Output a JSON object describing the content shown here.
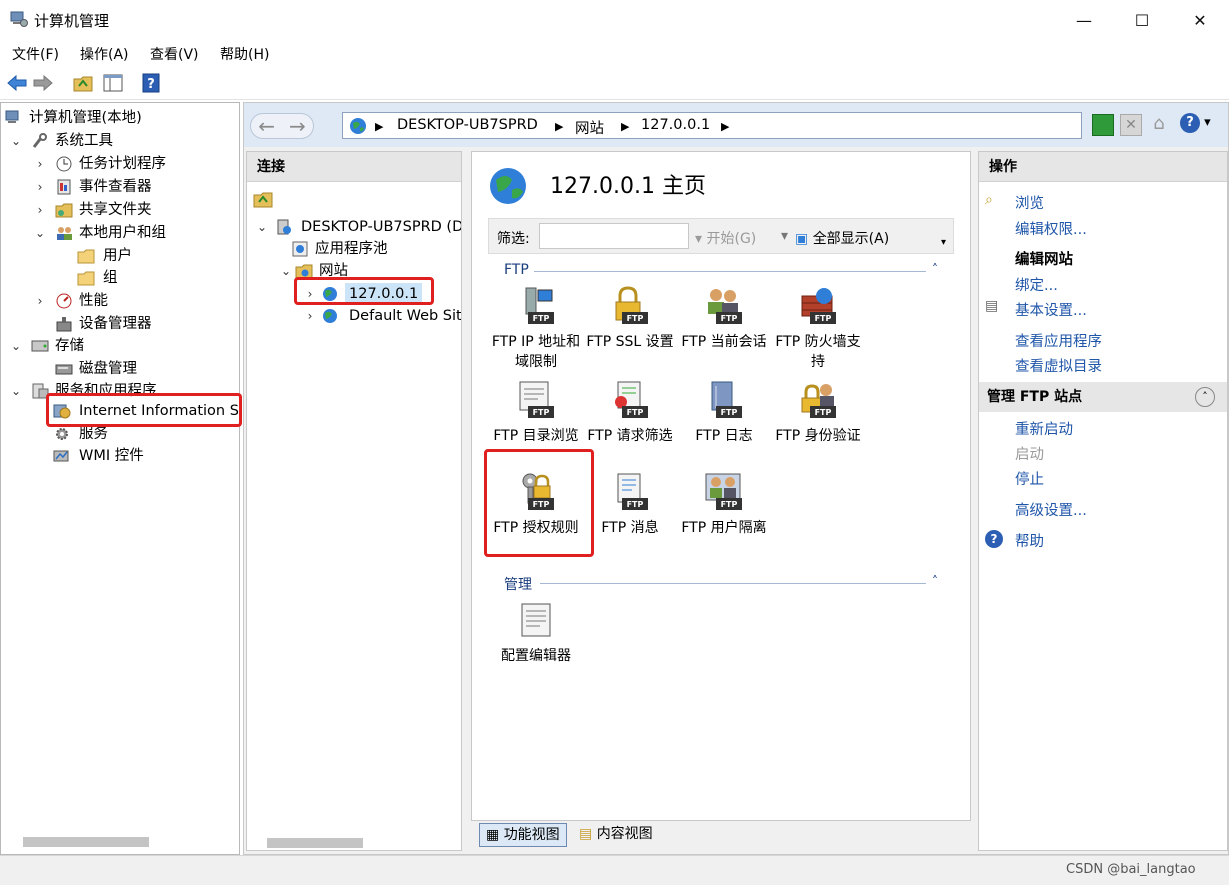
{
  "window": {
    "title": "计算机管理",
    "controls": [
      "—",
      "☐",
      "✕"
    ]
  },
  "menu": [
    "文件(F)",
    "操作(A)",
    "查看(V)",
    "帮助(H)"
  ],
  "left_tree": {
    "root": "计算机管理(本地)",
    "system_tools": "系统工具",
    "task_scheduler": "任务计划程序",
    "event_viewer": "事件查看器",
    "shared_folders": "共享文件夹",
    "local_users": "本地用户和组",
    "users": "用户",
    "groups": "组",
    "performance": "性能",
    "device_manager": "设备管理器",
    "storage": "存储",
    "disk_management": "磁盘管理",
    "services_apps": "服务和应用程序",
    "iis": "Internet Information Se",
    "services": "服务",
    "wmi": "WMI 控件"
  },
  "breadcrumb": [
    "DESKTOP-UB7SPRD",
    "网站",
    "127.0.0.1"
  ],
  "connections": {
    "header": "连接",
    "server": "DESKTOP-UB7SPRD (D",
    "app_pools": "应用程序池",
    "sites": "网站",
    "site_selected": "127.0.0.1",
    "default_site": "Default Web Site"
  },
  "center": {
    "title": "127.0.0.1 主页",
    "filter_label": "筛选:",
    "filter_placeholder": "",
    "start_label": "开始(G)",
    "show_all_label": "全部显示(A)",
    "ftp_section": "FTP",
    "manage_section": "管理",
    "features": {
      "ip": "FTP IP 地址和域限制",
      "ssl": "FTP SSL 设置",
      "sessions": "FTP 当前会话",
      "firewall": "FTP 防火墙支持",
      "browse": "FTP 目录浏览",
      "request": "FTP 请求筛选",
      "log": "FTP 日志",
      "auth": "FTP 身份验证",
      "authz": "FTP 授权规则",
      "msg": "FTP 消息",
      "isolation": "FTP 用户隔离",
      "config": "配置编辑器"
    },
    "view_features": "功能视图",
    "view_content": "内容视图"
  },
  "actions": {
    "header": "操作",
    "browse": "浏览",
    "edit_perms": "编辑权限...",
    "edit_site": "编辑网站",
    "bindings": "绑定...",
    "basic_settings": "基本设置...",
    "view_apps": "查看应用程序",
    "view_vdirs": "查看虚拟目录",
    "manage_ftp": "管理 FTP 站点",
    "restart": "重新启动",
    "start": "启动",
    "stop": "停止",
    "advanced": "高级设置...",
    "help": "帮助"
  },
  "watermark": "CSDN @bai_langtao",
  "colors": {
    "accent_link": "#1f56a8",
    "highlight_box": "#e0201f"
  }
}
